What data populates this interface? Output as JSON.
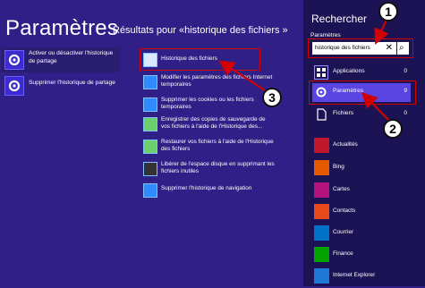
{
  "left": {
    "title": "Paramètres",
    "items": [
      {
        "label": "Activer ou désactiver l'historique de partage"
      },
      {
        "label": "Supprimer l'historique de partage"
      }
    ]
  },
  "results": {
    "title": "Résultats pour «historique des fichiers »",
    "items": [
      {
        "label": "Historique des fichiers"
      },
      {
        "label": "Modifier les paramètres des fichiers Internet temporaires"
      },
      {
        "label": "Supprimer les cookies ou les fichiers temporaires"
      },
      {
        "label": "Enregistrer des copies de sauvegarde de vos fichiers à l'aide de l'Historique des..."
      },
      {
        "label": "Restaurer vos fichiers à l'aide de l'Historique des fichiers"
      },
      {
        "label": "Libérer de l'espace disque en supprimant les fichiers inutiles"
      },
      {
        "label": "Supprimer l'historique de navigation"
      }
    ]
  },
  "search": {
    "title": "Rechercher",
    "scope_label": "Paramètres",
    "query": "historique des fichiers",
    "clear_glyph": "✕",
    "go_glyph": "⌕",
    "scopes": [
      {
        "label": "Applications",
        "count": "0",
        "icon": "apps-icon"
      },
      {
        "label": "Paramètres",
        "count": "9",
        "icon": "gear-icon"
      },
      {
        "label": "Fichiers",
        "count": "0",
        "icon": "files-icon"
      }
    ],
    "apps": [
      {
        "label": "Actualités",
        "icon": "news-icon",
        "color": "#c0172d"
      },
      {
        "label": "Bing",
        "icon": "bing-icon",
        "color": "#e55a00"
      },
      {
        "label": "Cartes",
        "icon": "maps-icon",
        "color": "#b4127c"
      },
      {
        "label": "Contacts",
        "icon": "people-icon",
        "color": "#e74a1a"
      },
      {
        "label": "Courrier",
        "icon": "mail-icon",
        "color": "#0072c6"
      },
      {
        "label": "Finance",
        "icon": "finance-icon",
        "color": "#00a300"
      },
      {
        "label": "Internet Explorer",
        "icon": "ie-icon",
        "color": "#1e78d4"
      }
    ]
  },
  "annotations": {
    "badge1": "1",
    "badge2": "2",
    "badge3": "3"
  }
}
